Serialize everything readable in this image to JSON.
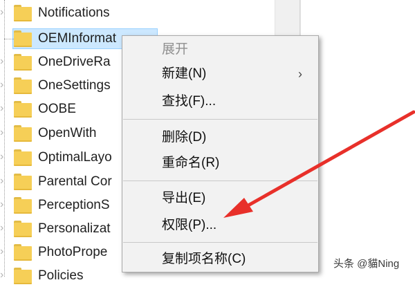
{
  "tree": {
    "items": [
      {
        "label": "Notifications"
      },
      {
        "label": "OEMInformat"
      },
      {
        "label": "OneDriveRa"
      },
      {
        "label": "OneSettings"
      },
      {
        "label": "OOBE"
      },
      {
        "label": "OpenWith"
      },
      {
        "label": "OptimalLayo"
      },
      {
        "label": "Parental Cor"
      },
      {
        "label": "PerceptionS"
      },
      {
        "label": "Personalizat"
      },
      {
        "label": "PhotoPrope"
      },
      {
        "label": "Policies"
      }
    ],
    "selected_index": 1
  },
  "context_menu": {
    "expand": "展开",
    "new": "新建(N)",
    "new_submenu_icon": "chevron-right-icon",
    "find": "查找(F)...",
    "delete": "删除(D)",
    "rename": "重命名(R)",
    "export": "导出(E)",
    "permissions": "权限(P)...",
    "copy_key_name": "复制项名称(C)"
  },
  "annotation": {
    "arrow_color": "#e8302a"
  },
  "watermark": "头条 @貓Ning",
  "colors": {
    "selection": "#cce8ff",
    "folder": "#f6cf57",
    "menu_bg": "#f2f2f2"
  }
}
